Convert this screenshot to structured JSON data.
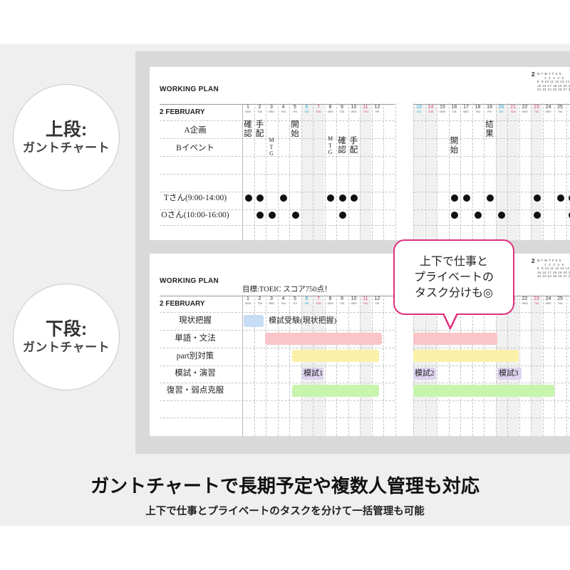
{
  "labels": {
    "upper_big": "上段:",
    "upper_small": "ガントチャート",
    "lower_big": "下段:",
    "lower_small": "ガントチャート"
  },
  "plan": {
    "title": "WORKING PLAN",
    "month": "2  FEBRUARY",
    "goal": "目標:TOEIC スコア750点！"
  },
  "days_left": [
    {
      "d": "1",
      "w": "MON",
      "t": ""
    },
    {
      "d": "2",
      "w": "TUE",
      "t": ""
    },
    {
      "d": "3",
      "w": "WED",
      "t": ""
    },
    {
      "d": "4",
      "w": "THU",
      "t": ""
    },
    {
      "d": "5",
      "w": "FRI",
      "t": ""
    },
    {
      "d": "6",
      "w": "SAT",
      "t": "sat"
    },
    {
      "d": "7",
      "w": "SUN",
      "t": "sun"
    },
    {
      "d": "8",
      "w": "MON",
      "t": ""
    },
    {
      "d": "9",
      "w": "TUE",
      "t": ""
    },
    {
      "d": "10",
      "w": "WED",
      "t": ""
    },
    {
      "d": "11",
      "w": "THU",
      "t": "hol"
    },
    {
      "d": "12",
      "w": "FRI",
      "t": ""
    }
  ],
  "days_right": [
    {
      "d": "13",
      "w": "SAT",
      "t": "sat"
    },
    {
      "d": "14",
      "w": "SUN",
      "t": "sun"
    },
    {
      "d": "15",
      "w": "MON",
      "t": ""
    },
    {
      "d": "16",
      "w": "TUE",
      "t": ""
    },
    {
      "d": "17",
      "w": "WED",
      "t": ""
    },
    {
      "d": "18",
      "w": "THU",
      "t": ""
    },
    {
      "d": "19",
      "w": "FRI",
      "t": ""
    },
    {
      "d": "20",
      "w": "SAT",
      "t": "sat"
    },
    {
      "d": "21",
      "w": "SUN",
      "t": "sun"
    },
    {
      "d": "22",
      "w": "MON",
      "t": ""
    },
    {
      "d": "23",
      "w": "TUE",
      "t": "hol"
    },
    {
      "d": "24",
      "w": "WED",
      "t": ""
    },
    {
      "d": "25",
      "w": "THU",
      "t": ""
    }
  ],
  "mini_calendar": {
    "month": "2",
    "rows": [
      "M T W T F S S",
      "      1  2  3  4  5",
      "8  9 10 11 12 13 14",
      "15 16 17 18 19 20 21",
      "22 23 24 25 26 27 28"
    ]
  },
  "upper_rows": [
    "A企画",
    "Bイベント",
    "Tさん(9:00-14:00)",
    "Oさん(10:00-16:00)"
  ],
  "upper_vtexts": [
    "確\n認",
    "手\n配",
    "M\nT\nG",
    "開\n始",
    "M\nT\nG",
    "確\n認",
    "手\n配",
    "開\n始",
    "結\n果"
  ],
  "lower_rows": [
    "現状把握",
    "単語・文法",
    "part別対策",
    "模試・演習",
    "復習・弱点克服"
  ],
  "lower_bars": [
    {
      "label": "",
      "color": "#c7dcf5"
    },
    {
      "label": "模試受験(現状把握)",
      "color": "none"
    },
    {
      "label": "",
      "color": "#f9c5c8"
    },
    {
      "label": "",
      "color": "#f9c5c8"
    },
    {
      "label": "",
      "color": "#fbf0a8"
    },
    {
      "label": "",
      "color": "#fbf0a8"
    },
    {
      "label": "模試1",
      "color": "#ded4f0"
    },
    {
      "label": "模試2",
      "color": "#ded4f0"
    },
    {
      "label": "模試3",
      "color": "#ded4f0"
    },
    {
      "label": "",
      "color": "#c7f5ad"
    },
    {
      "label": "",
      "color": "#c7f5ad"
    }
  ],
  "callout": "上下で仕事と\nプライベートの\nタスク分けも◎",
  "headline": "ガントチャートで長期予定や複数人管理も対応",
  "subline": "上下で仕事とプライベートのタスクを分けて一括管理も可能"
}
